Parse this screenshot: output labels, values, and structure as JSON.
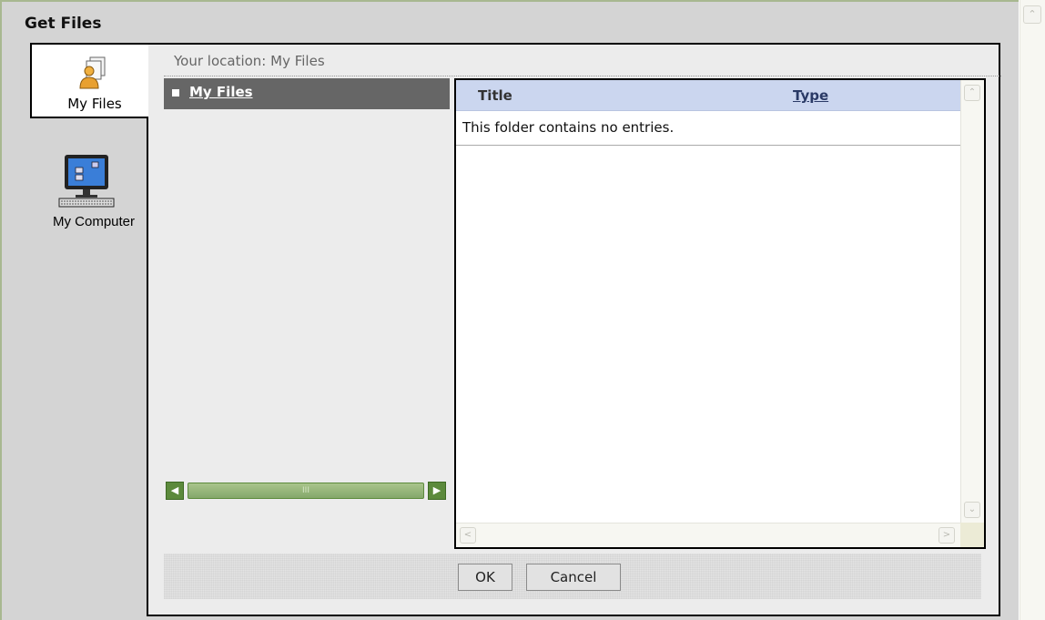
{
  "dialog": {
    "title": "Get Files"
  },
  "tabs": [
    {
      "label": "My Files",
      "icon": "user-files-icon",
      "selected": true
    },
    {
      "label": "My Computer",
      "icon": "computer-icon",
      "selected": false
    }
  ],
  "location": {
    "text": "Your location: My Files"
  },
  "tree": {
    "items": [
      {
        "label": "My Files",
        "selected": true
      }
    ],
    "scroll_thumb_grip": "III"
  },
  "list": {
    "columns": [
      {
        "label": "Title",
        "sortable": false
      },
      {
        "label": "Type",
        "sortable": true
      }
    ],
    "empty_message": "This folder contains no entries."
  },
  "footer": {
    "ok_label": "OK",
    "cancel_label": "Cancel"
  },
  "colors": {
    "tree_selected_bg": "#666666",
    "list_header_bg": "#cbd6ef",
    "scroll_green": "#5c8a3c",
    "dialog_bg": "#d4d4d4"
  }
}
